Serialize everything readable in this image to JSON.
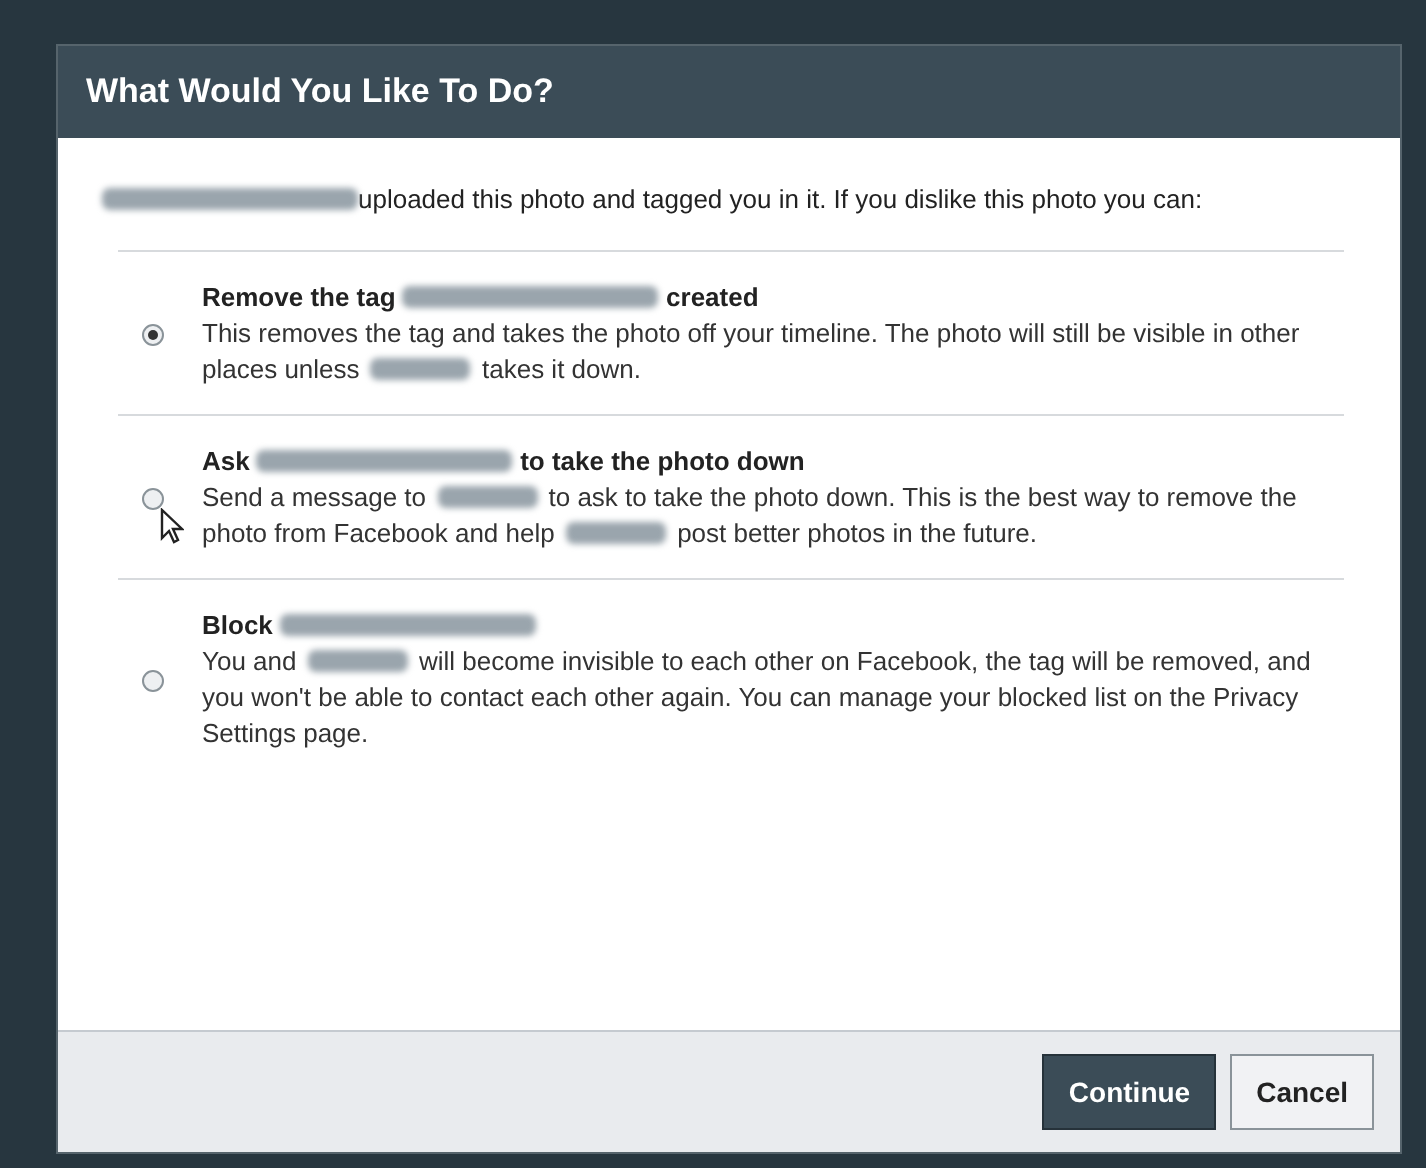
{
  "dialog": {
    "title": "What Would You Like To Do?",
    "intro": [
      {
        "kind": "full-name"
      },
      {
        "kind": "text",
        "text": "uploaded this photo and tagged you in it. If you dislike this photo you can:"
      }
    ],
    "options": [
      {
        "selected": true,
        "heading": [
          {
            "kind": "text",
            "text": "Remove the tag "
          },
          {
            "kind": "full-name"
          },
          {
            "kind": "text",
            "text": " created"
          }
        ],
        "description": [
          {
            "kind": "text",
            "text": "This removes the tag and takes the photo off your timeline. The photo will still be visible in other places unless "
          },
          {
            "kind": "first-name"
          },
          {
            "kind": "text",
            "text": " takes it down."
          }
        ]
      },
      {
        "selected": false,
        "pointer": true,
        "heading": [
          {
            "kind": "text",
            "text": "Ask "
          },
          {
            "kind": "full-name"
          },
          {
            "kind": "text",
            "text": " to take the photo down"
          }
        ],
        "description": [
          {
            "kind": "text",
            "text": "Send a message to "
          },
          {
            "kind": "first-name"
          },
          {
            "kind": "text",
            "text": " to ask to take the photo down. This is the best way to remove the photo from Facebook and help "
          },
          {
            "kind": "first-name"
          },
          {
            "kind": "text",
            "text": " post better photos in the future."
          }
        ]
      },
      {
        "selected": false,
        "heading": [
          {
            "kind": "text",
            "text": "Block "
          },
          {
            "kind": "full-name"
          }
        ],
        "description": [
          {
            "kind": "text",
            "text": "You and "
          },
          {
            "kind": "first-name"
          },
          {
            "kind": "text",
            "text": " will become invisible to each other on Facebook, the tag will be removed, and you won't be able to contact each other again. You can manage your blocked list on the Privacy Settings page."
          }
        ]
      }
    ],
    "buttons": [
      {
        "kind": "primary",
        "label": "Continue"
      },
      {
        "kind": "secondary",
        "label": "Cancel"
      }
    ]
  }
}
